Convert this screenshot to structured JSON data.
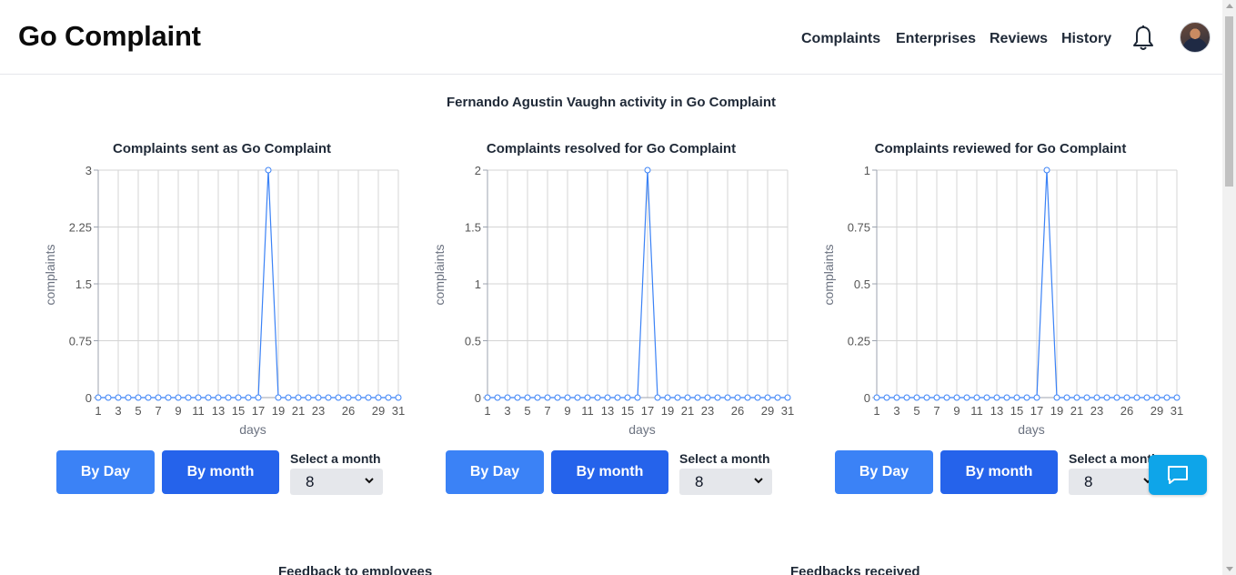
{
  "header": {
    "brand": "Go Complaint",
    "nav": [
      "Complaints",
      "Enterprises",
      "Reviews",
      "History"
    ],
    "icons": [
      "bell-icon",
      "avatar"
    ]
  },
  "page_title": "Fernando Agustin Vaughn activity in Go Complaint",
  "controls": {
    "by_day_label": "By Day",
    "by_month_label": "By month",
    "select_label": "Select a month",
    "selected_month": "8"
  },
  "colors": {
    "primary": "#3b82f6",
    "primary_dark": "#2563eb",
    "chat": "#0ea5e9",
    "line": "#3b82f6"
  },
  "chart_data": [
    {
      "type": "line",
      "title": "Complaints sent as Go Complaint",
      "xlabel": "days",
      "ylabel": "complaints",
      "x": [
        1,
        2,
        3,
        4,
        5,
        6,
        7,
        8,
        9,
        10,
        11,
        12,
        13,
        14,
        15,
        16,
        17,
        18,
        19,
        20,
        21,
        22,
        23,
        24,
        25,
        26,
        27,
        28,
        29,
        30,
        31
      ],
      "values": [
        0,
        0,
        0,
        0,
        0,
        0,
        0,
        0,
        0,
        0,
        0,
        0,
        0,
        0,
        0,
        0,
        0,
        3,
        0,
        0,
        0,
        0,
        0,
        0,
        0,
        0,
        0,
        0,
        0,
        0,
        0
      ],
      "ylim": [
        0,
        3
      ],
      "yticks": [
        "0",
        "0.75",
        "1.5",
        "2.25",
        "3"
      ],
      "xticks": [
        "1",
        "3",
        "5",
        "7",
        "9",
        "11",
        "13",
        "15",
        "17",
        "19",
        "21",
        "23",
        "26",
        "29",
        "31"
      ],
      "grid": true
    },
    {
      "type": "line",
      "title": "Complaints resolved for Go Complaint",
      "xlabel": "days",
      "ylabel": "complaints",
      "x": [
        1,
        2,
        3,
        4,
        5,
        6,
        7,
        8,
        9,
        10,
        11,
        12,
        13,
        14,
        15,
        16,
        17,
        18,
        19,
        20,
        21,
        22,
        23,
        24,
        25,
        26,
        27,
        28,
        29,
        30,
        31
      ],
      "values": [
        0,
        0,
        0,
        0,
        0,
        0,
        0,
        0,
        0,
        0,
        0,
        0,
        0,
        0,
        0,
        0,
        2,
        0,
        0,
        0,
        0,
        0,
        0,
        0,
        0,
        0,
        0,
        0,
        0,
        0,
        0
      ],
      "ylim": [
        0,
        2
      ],
      "yticks": [
        "0",
        "0.5",
        "1",
        "1.5",
        "2"
      ],
      "xticks": [
        "1",
        "3",
        "5",
        "7",
        "9",
        "11",
        "13",
        "15",
        "17",
        "19",
        "21",
        "23",
        "26",
        "29",
        "31"
      ],
      "grid": true
    },
    {
      "type": "line",
      "title": "Complaints reviewed for Go Complaint",
      "xlabel": "days",
      "ylabel": "complaints",
      "x": [
        1,
        2,
        3,
        4,
        5,
        6,
        7,
        8,
        9,
        10,
        11,
        12,
        13,
        14,
        15,
        16,
        17,
        18,
        19,
        20,
        21,
        22,
        23,
        24,
        25,
        26,
        27,
        28,
        29,
        30,
        31
      ],
      "values": [
        0,
        0,
        0,
        0,
        0,
        0,
        0,
        0,
        0,
        0,
        0,
        0,
        0,
        0,
        0,
        0,
        0,
        1,
        0,
        0,
        0,
        0,
        0,
        0,
        0,
        0,
        0,
        0,
        0,
        0,
        0
      ],
      "ylim": [
        0,
        1
      ],
      "yticks": [
        "0",
        "0.25",
        "0.5",
        "0.75",
        "1"
      ],
      "xticks": [
        "1",
        "3",
        "5",
        "7",
        "9",
        "11",
        "13",
        "15",
        "17",
        "19",
        "21",
        "23",
        "26",
        "29",
        "31"
      ],
      "grid": true
    }
  ],
  "sections": {
    "feedback_to_employees": "Feedback to employees",
    "feedbacks_received": "Feedbacks received"
  }
}
